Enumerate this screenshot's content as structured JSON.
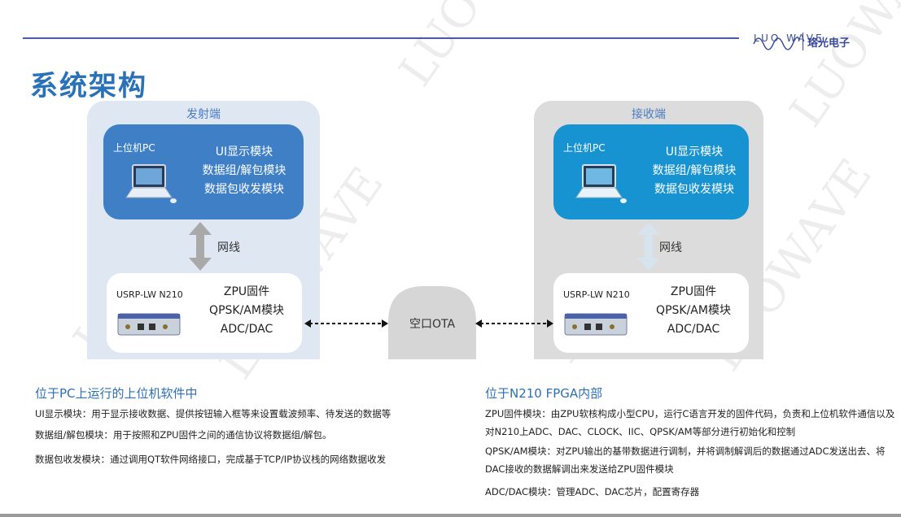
{
  "header": {
    "logo_text": "LUO WAVE",
    "logo_cn": "珞光电子",
    "title": "系统架构"
  },
  "watermark_text": "LUOWAVE",
  "colors": {
    "accent": "#2a72b8",
    "tx_panel": "#dfe7f2",
    "rx_panel": "#dcdcdc",
    "tx_pc": "#3f7fc6",
    "rx_pc": "#1893d2",
    "ota": "#d6d6d6"
  },
  "transmitter": {
    "label": "发射端",
    "pc": {
      "label": "上位机PC",
      "modules": [
        "UI显示模块",
        "数据组/解包模块",
        "数据包收发模块"
      ]
    },
    "link_label": "网线",
    "usrp": {
      "label": "USRP-LW N210",
      "modules": [
        "ZPU固件",
        "QPSK/AM模块",
        "ADC/DAC"
      ]
    }
  },
  "receiver": {
    "label": "接收端",
    "pc": {
      "label": "上位机PC",
      "modules": [
        "UI显示模块",
        "数据组/解包模块",
        "数据包收发模块"
      ]
    },
    "link_label": "网线",
    "usrp": {
      "label": "USRP-LW N210",
      "modules": [
        "ZPU固件",
        "QPSK/AM模块",
        "ADC/DAC"
      ]
    }
  },
  "ota_label": "空口OTA",
  "pc_section": {
    "title": "位于PC上运行的上位机软件中",
    "items": [
      "UI显示模块：用于显示接收数据、提供按钮输入框等来设置载波频率、待发送的数据等",
      "数据组/解包模块：用于按照和ZPU固件之间的通信协议将数据组/解包。",
      "数据包收发模块：通过调用QT软件网络接口，完成基于TCP/IP协议栈的网络数据收发"
    ]
  },
  "fpga_section": {
    "title": "位于N210 FPGA内部",
    "items": [
      "ZPU固件模块：由ZPU软核构成小型CPU，运行C语言开发的固件代码，负责和上位机软件通信以及对N210上ADC、DAC、CLOCK、IIC、QPSK/AM等部分进行初始化和控制",
      "QPSK/AM模块：对ZPU输出的基带数据进行调制，并将调制解调后的数据通过ADC发送出去、将DAC接收的数据解调出来发送给ZPU固件模块",
      "ADC/DAC模块：管理ADC、DAC芯片，配置寄存器"
    ]
  }
}
